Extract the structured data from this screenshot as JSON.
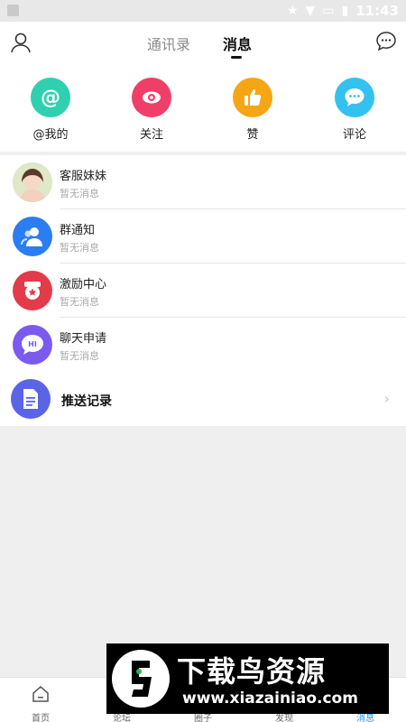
{
  "status": {
    "time": "11:43",
    "icons": [
      "star-icon",
      "wifi-icon",
      "no-sim-icon",
      "battery-icon"
    ]
  },
  "topbar": {
    "tabs": [
      {
        "label": "通讯录"
      },
      {
        "label": "消息"
      }
    ],
    "active_tab": "消息"
  },
  "quick": [
    {
      "label": "@我的",
      "icon": "at-icon",
      "color": "#2fd0b0"
    },
    {
      "label": "关注",
      "icon": "eye-icon",
      "color": "#ef3f69"
    },
    {
      "label": "赞",
      "icon": "thumbs-up-icon",
      "color": "#f6a514"
    },
    {
      "label": "评论",
      "icon": "comment-icon",
      "color": "#33c2ef"
    }
  ],
  "messages": [
    {
      "title": "客服妹妹",
      "sub": "暂无消息",
      "icon": "avatar-photo",
      "color": "#f1c7b4"
    },
    {
      "title": "群通知",
      "sub": "暂无消息",
      "icon": "group-icon",
      "color": "#2c7df2"
    },
    {
      "title": "激励中心",
      "sub": "暂无消息",
      "icon": "badge-icon",
      "color": "#e23c4a"
    },
    {
      "title": "聊天申请",
      "sub": "暂无消息",
      "icon": "hi-chat-icon",
      "color": "#7b5af0"
    }
  ],
  "push": {
    "title": "推送记录",
    "icon": "document-icon",
    "color": "#5b63e6"
  },
  "bottom_nav": [
    {
      "label": "首页",
      "icon": "home-icon"
    },
    {
      "label": "论坛",
      "icon": "forum-icon"
    },
    {
      "label": "圈子",
      "icon": "circle-icon"
    },
    {
      "label": "发现",
      "icon": "discover-icon"
    },
    {
      "label": "消息",
      "icon": "message-icon",
      "active": true
    }
  ],
  "watermark": {
    "title": "下载鸟资源",
    "url": "www.xiazainiao.com"
  }
}
